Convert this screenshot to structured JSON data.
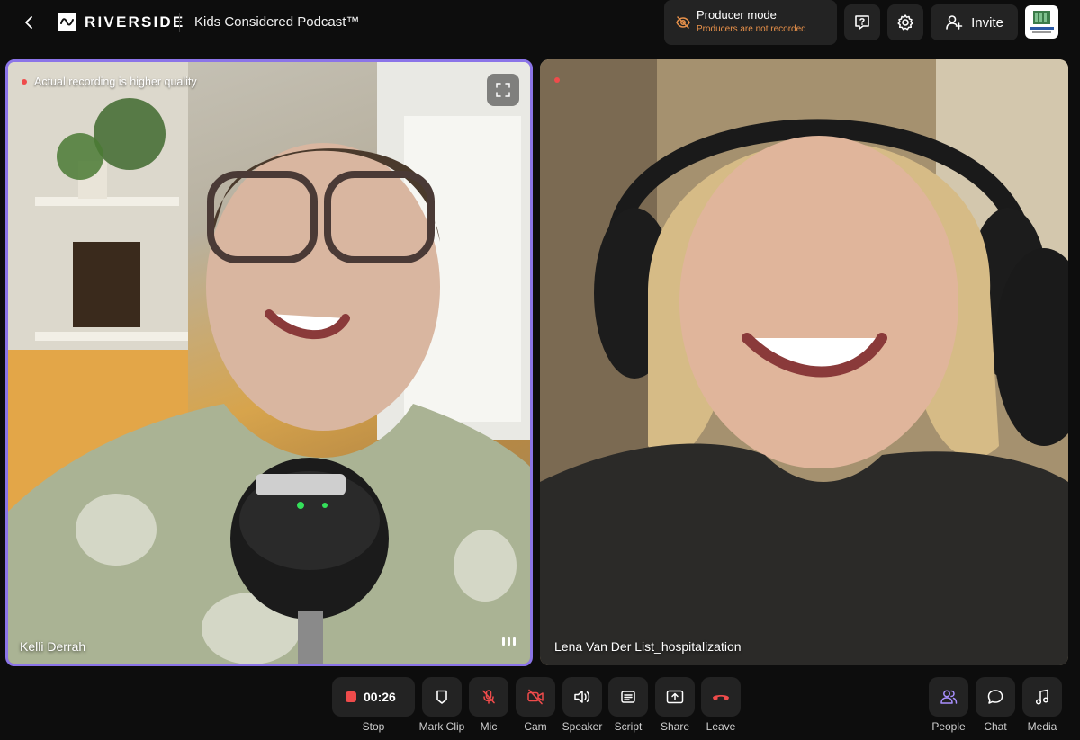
{
  "header": {
    "logo_text": "RIVERSIDE",
    "studio_title": "Kids Considered Podcast™",
    "producer_mode": {
      "title": "Producer mode",
      "subtitle": "Producers are not recorded"
    },
    "invite_label": "Invite"
  },
  "tiles": [
    {
      "name": "Kelli Derrah",
      "note": "Actual recording is higher quality",
      "mic_brand": "SHURE",
      "active": true
    },
    {
      "name": "Lena Van Der List_hospitalization",
      "active": false
    }
  ],
  "toolbar": {
    "timer": "00:26",
    "stop_label": "Stop",
    "mark_clip_label": "Mark Clip",
    "mic_label": "Mic",
    "cam_label": "Cam",
    "speaker_label": "Speaker",
    "script_label": "Script",
    "share_label": "Share",
    "leave_label": "Leave",
    "people_label": "People",
    "chat_label": "Chat",
    "media_label": "Media"
  },
  "colors": {
    "background": "#0d0d0d",
    "button": "#232323",
    "active_border": "#8b74e8",
    "record_red": "#ef4b4b",
    "producer_orange": "#e8914a",
    "people_purple": "#a990ff"
  },
  "icons": {
    "back": "chevron-left-icon",
    "producer": "eye-off-icon",
    "help": "help-bubble-icon",
    "settings": "gear-icon",
    "invite": "add-user-icon",
    "mark_clip": "clip-icon",
    "mic": "mic-off-icon",
    "cam": "camera-off-icon",
    "speaker": "speaker-icon",
    "script": "script-icon",
    "share": "share-icon",
    "leave": "hangup-icon",
    "people": "people-icon",
    "chat": "chat-icon",
    "media": "music-note-icon"
  }
}
